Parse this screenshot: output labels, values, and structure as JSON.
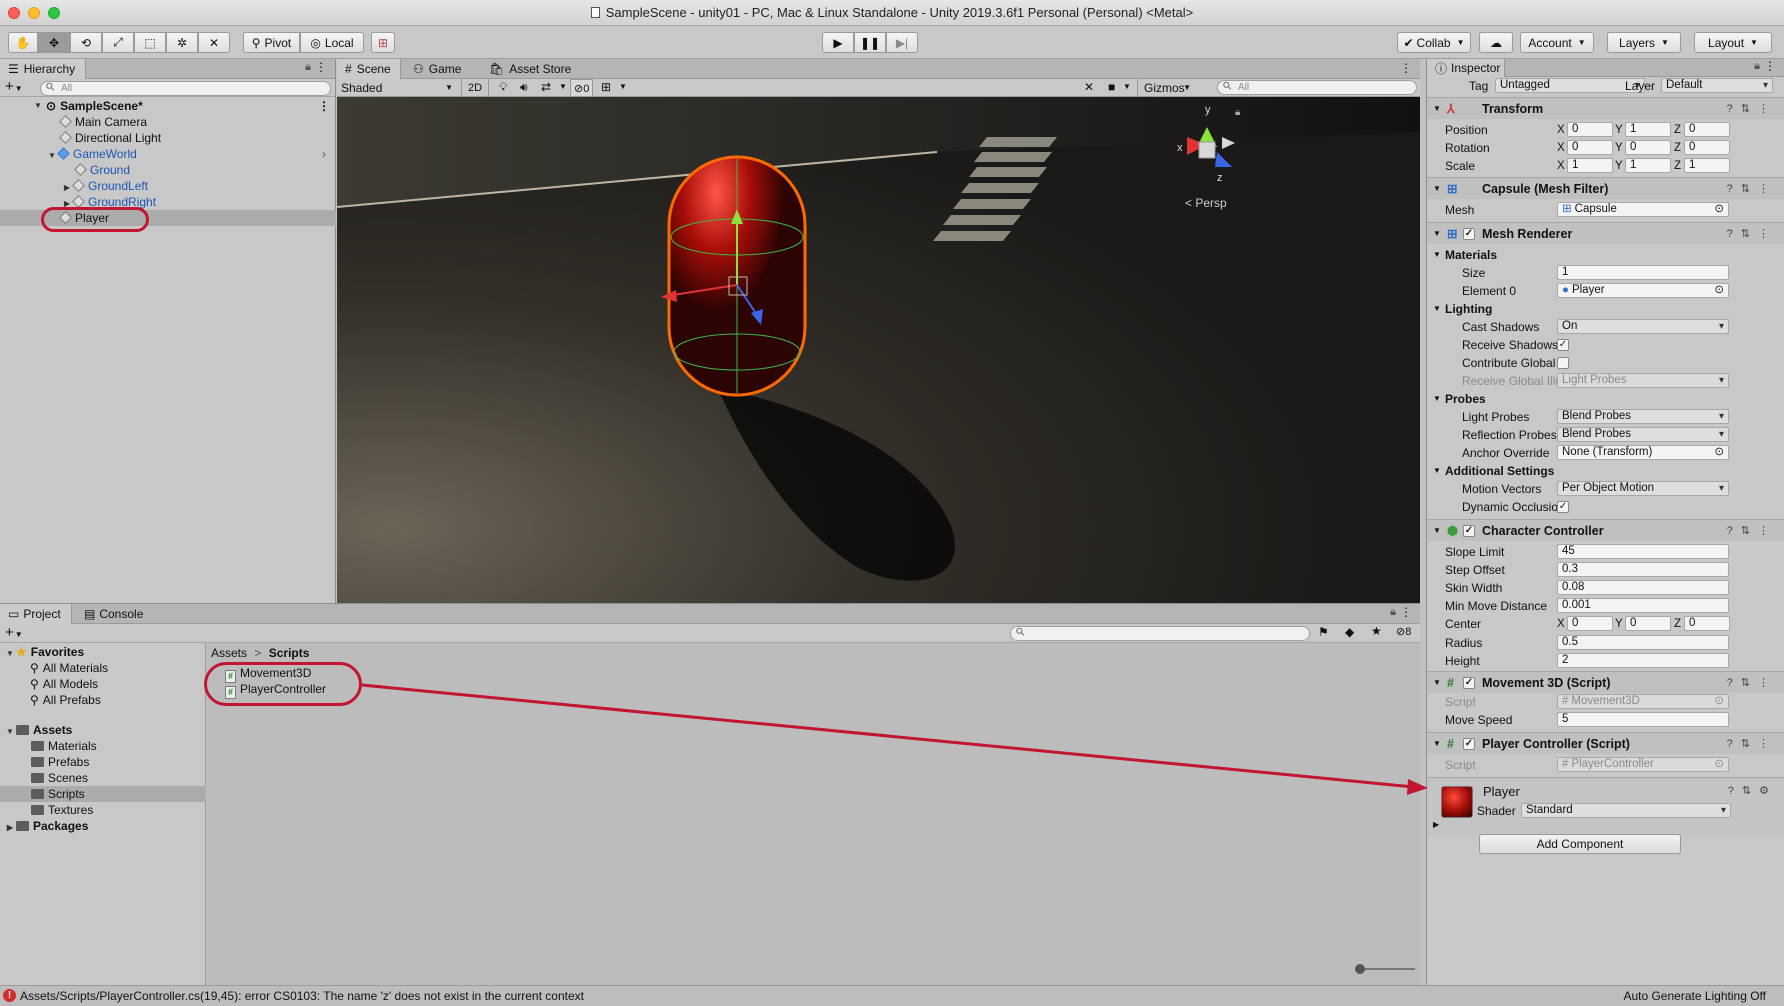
{
  "window": {
    "title": "SampleScene - unity01 - PC, Mac & Linux Standalone - Unity 2019.3.6f1 Personal (Personal) <Metal>"
  },
  "toolbar": {
    "pivot": "Pivot",
    "local": "Local",
    "collab": "Collab",
    "account": "Account",
    "layers": "Layers",
    "layout": "Layout"
  },
  "hierarchy": {
    "tab": "Hierarchy",
    "search_placeholder": "All",
    "scene": "SampleScene*",
    "items": [
      "Main Camera",
      "Directional Light",
      "GameWorld",
      "Ground",
      "GroundLeft",
      "GroundRight",
      "Player"
    ]
  },
  "scene_view": {
    "tabs": [
      "Scene",
      "Game",
      "Asset Store"
    ],
    "shading": "Shaded",
    "mode_2d": "2D",
    "hidden_count": "0",
    "gizmos": "Gizmos",
    "search_placeholder": "All",
    "persp": "< Persp",
    "axis": {
      "x": "x",
      "y": "y",
      "z": "z"
    }
  },
  "project": {
    "tabs": [
      "Project",
      "Console"
    ],
    "hidden_count": "8",
    "favorites": {
      "label": "Favorites",
      "items": [
        "All Materials",
        "All Models",
        "All Prefabs"
      ]
    },
    "assets": {
      "label": "Assets",
      "items": [
        "Materials",
        "Prefabs",
        "Scenes",
        "Scripts",
        "Textures"
      ]
    },
    "packages": "Packages",
    "breadcrumb": {
      "root": "Assets",
      "sep": ">",
      "current": "Scripts"
    },
    "files": [
      "Movement3D",
      "PlayerController"
    ]
  },
  "inspector": {
    "tab": "Inspector",
    "tag_label": "Tag",
    "tag_value": "Untagged",
    "layer_label": "Layer",
    "layer_value": "Default",
    "transform": {
      "title": "Transform",
      "position": {
        "label": "Position",
        "x": "0",
        "y": "1",
        "z": "0"
      },
      "rotation": {
        "label": "Rotation",
        "x": "0",
        "y": "0",
        "z": "0"
      },
      "scale": {
        "label": "Scale",
        "x": "1",
        "y": "1",
        "z": "1"
      }
    },
    "mesh_filter": {
      "title": "Capsule (Mesh Filter)",
      "mesh_label": "Mesh",
      "mesh_value": "Capsule"
    },
    "mesh_renderer": {
      "title": "Mesh Renderer",
      "materials": "Materials",
      "size_label": "Size",
      "size_value": "1",
      "element0_label": "Element 0",
      "element0_value": "Player",
      "lighting": "Lighting",
      "cast_shadows_label": "Cast Shadows",
      "cast_shadows_value": "On",
      "receive_shadows_label": "Receive Shadows",
      "contribute_gi_label": "Contribute Global Il",
      "receive_gi_label": "Receive Global Illu",
      "receive_gi_value": "Light Probes",
      "probes": "Probes",
      "light_probes_label": "Light Probes",
      "light_probes_value": "Blend Probes",
      "reflection_probes_label": "Reflection Probes",
      "reflection_probes_value": "Blend Probes",
      "anchor_override_label": "Anchor Override",
      "anchor_override_value": "None (Transform)",
      "additional": "Additional Settings",
      "motion_vectors_label": "Motion Vectors",
      "motion_vectors_value": "Per Object Motion",
      "dynamic_occlusion_label": "Dynamic Occlusion"
    },
    "character_controller": {
      "title": "Character Controller",
      "slope_limit_label": "Slope Limit",
      "slope_limit_value": "45",
      "step_offset_label": "Step Offset",
      "step_offset_value": "0.3",
      "skin_width_label": "Skin Width",
      "skin_width_value": "0.08",
      "min_move_label": "Min Move Distance",
      "min_move_value": "0.001",
      "center_label": "Center",
      "center_x": "0",
      "center_y": "0",
      "center_z": "0",
      "radius_label": "Radius",
      "radius_value": "0.5",
      "height_label": "Height",
      "height_value": "2"
    },
    "movement3d": {
      "title": "Movement 3D (Script)",
      "script_label": "Script",
      "script_value": "Movement3D",
      "move_speed_label": "Move Speed",
      "move_speed_value": "5"
    },
    "player_controller": {
      "title": "Player Controller (Script)",
      "script_label": "Script",
      "script_value": "PlayerController"
    },
    "material": {
      "name": "Player",
      "shader_label": "Shader",
      "shader_value": "Standard"
    },
    "add_component": "Add Component"
  },
  "status": {
    "error": "Assets/Scripts/PlayerController.cs(19,45): error CS0103: The name 'z' does not exist in the current context",
    "lighting": "Auto Generate Lighting Off"
  },
  "colors": {
    "annotation": "#c21530",
    "player": "#c0120f",
    "selection": "#ff6a00"
  }
}
